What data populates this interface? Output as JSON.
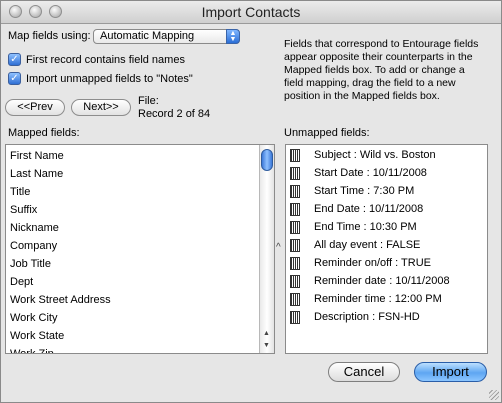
{
  "window": {
    "title": "Import Contacts"
  },
  "options": {
    "map_fields_label": "Map fields using:",
    "map_fields_value": "Automatic Mapping",
    "first_record_label": "First record contains field names",
    "import_unmapped_label": "Import unmapped fields to \"Notes\"",
    "first_record_checked": true,
    "import_unmapped_checked": true
  },
  "help_text": [
    "Fields that correspond to Entourage fields",
    "appear opposite their counterparts in the",
    "Mapped fields box. To add or change a",
    "field mapping, drag the field to a new",
    "position in the Mapped fields box."
  ],
  "nav": {
    "prev_label": "<<Prev",
    "next_label": "Next>>",
    "file_label": "File:",
    "record_text": "Record 2 of 84"
  },
  "mapped": {
    "header": "Mapped fields:",
    "items": [
      "First Name",
      "Last Name",
      "Title",
      "Suffix",
      "Nickname",
      "Company",
      "Job Title",
      "Dept",
      "Work Street Address",
      "Work City",
      "Work State",
      "Work Zip"
    ]
  },
  "unmapped": {
    "header": "Unmapped fields:",
    "items": [
      "Subject : Wild vs. Boston",
      "Start Date : 10/11/2008",
      "Start Time : 7:30 PM",
      "End Date : 10/11/2008",
      "End Time : 10:30 PM",
      "All day event : FALSE",
      "Reminder on/off : TRUE",
      "Reminder date : 10/11/2008",
      "Reminder time : 12:00 PM",
      "Description : FSN-HD"
    ]
  },
  "actions": {
    "cancel_label": "Cancel",
    "import_label": "Import"
  }
}
